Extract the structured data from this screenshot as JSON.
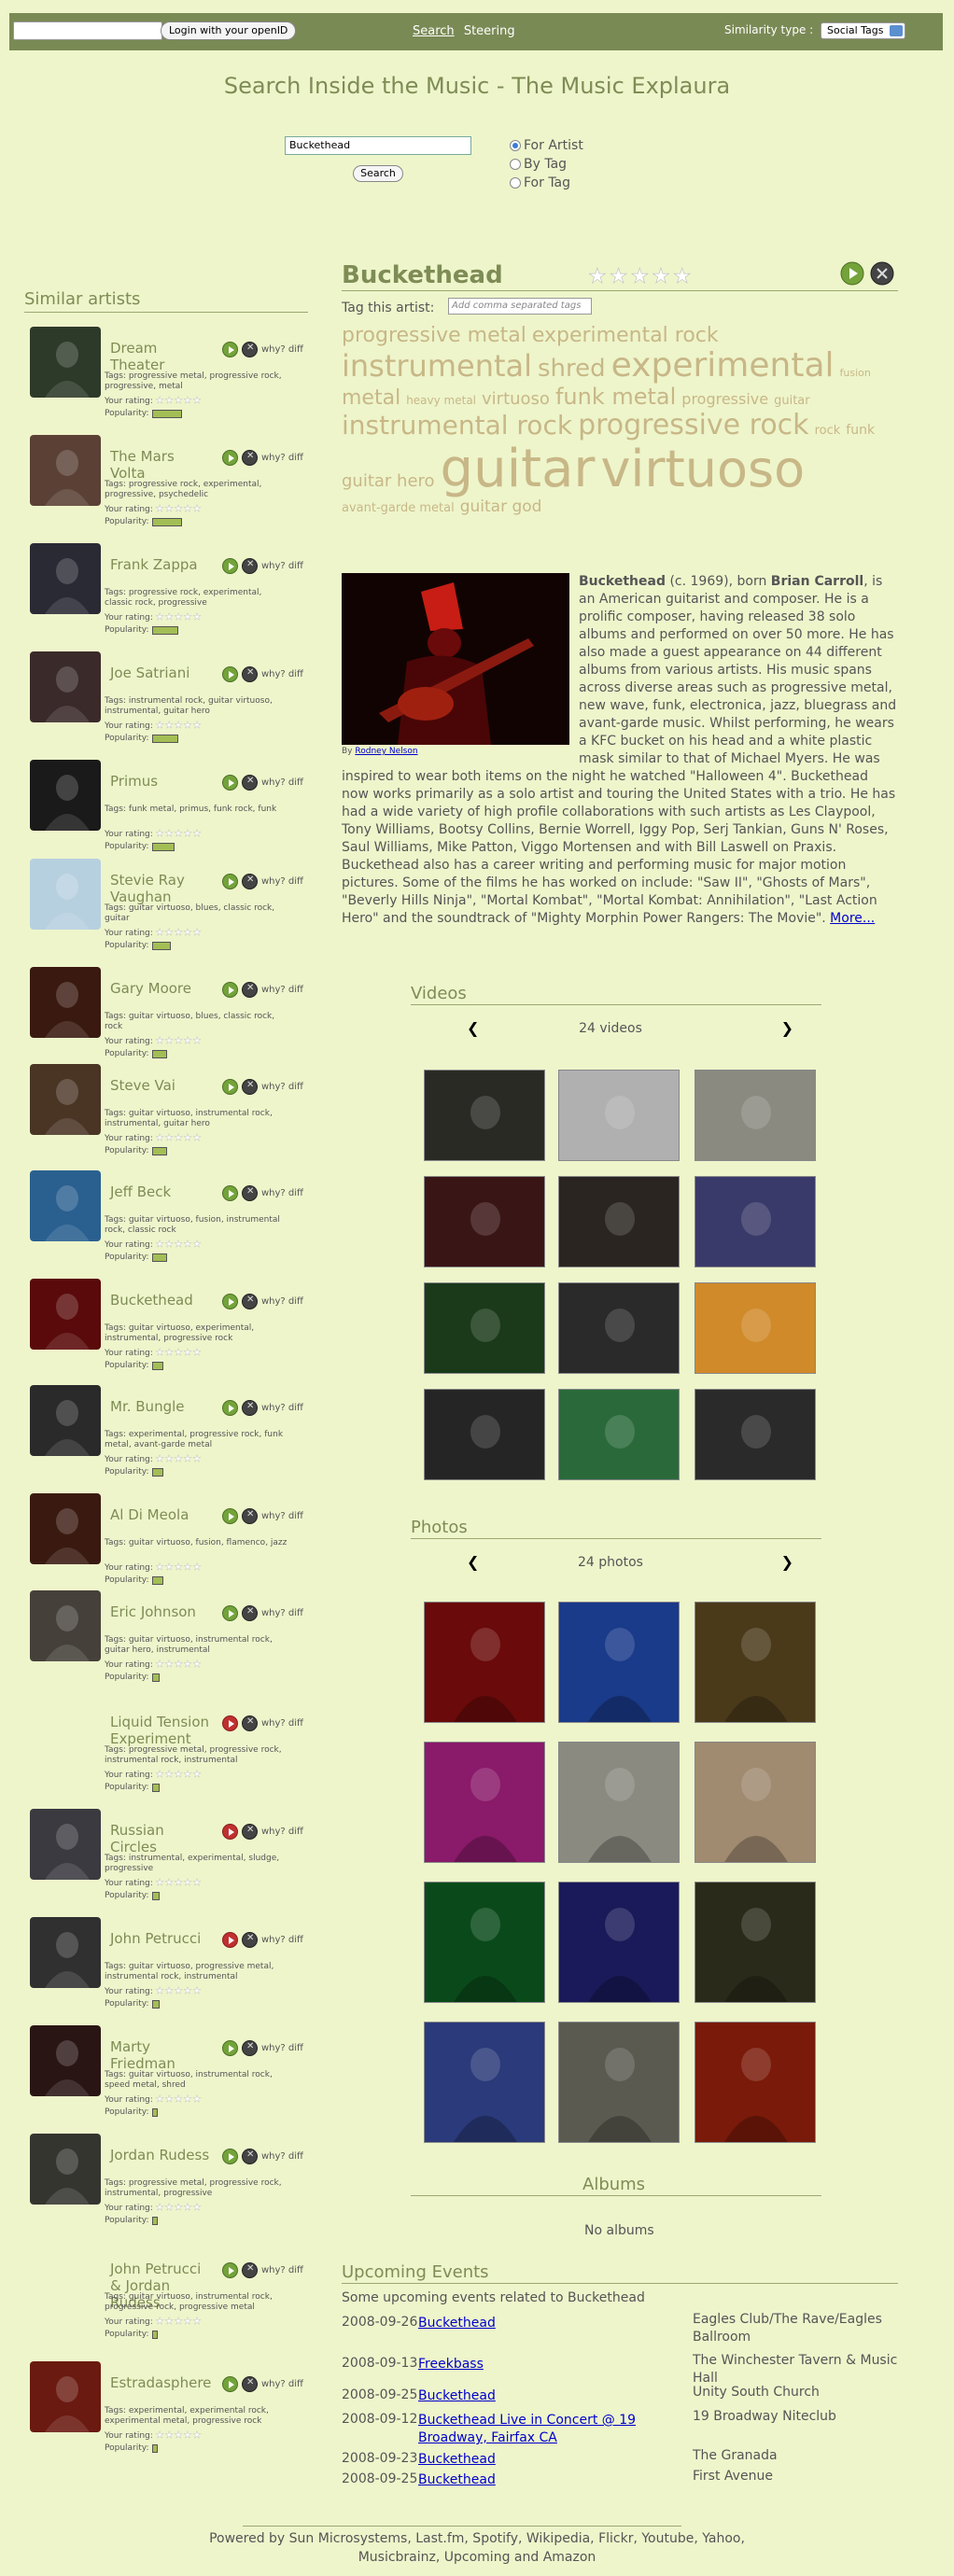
{
  "topbar": {
    "login_label": "Login with your openID",
    "nav_search": "Search",
    "nav_steering": "Steering",
    "similarity_label": "Similarity type :",
    "similarity_value": "Social Tags"
  },
  "page_title": "Search Inside the Music - The Music Explaura",
  "search": {
    "query": "Buckethead",
    "button": "Search",
    "options": [
      "For Artist",
      "By Tag",
      "For Tag"
    ],
    "selected": "For Artist"
  },
  "similar": {
    "title": "Similar artists",
    "tags_prefix": "Tags:",
    "rating_label": "Your rating:",
    "popularity_label": "Popularity:",
    "why_label": "why? diff",
    "items": [
      {
        "name": "Dream Theater",
        "tags": "progressive metal, progressive rock, progressive, metal",
        "popularity": 0.8,
        "play": "green",
        "thumb": "#2d3a2a"
      },
      {
        "name": "The Mars Volta",
        "tags": "progressive rock, experimental, progressive, psychedelic",
        "popularity": 0.8,
        "play": "green",
        "thumb": "#5a4035"
      },
      {
        "name": "Frank Zappa",
        "tags": "progressive rock, experimental, classic rock, progressive",
        "popularity": 0.7,
        "play": "green",
        "thumb": "#2a2a35"
      },
      {
        "name": "Joe Satriani",
        "tags": "instrumental rock, guitar virtuoso, instrumental, guitar hero",
        "popularity": 0.7,
        "play": "green",
        "thumb": "#3a2a2a"
      },
      {
        "name": "Primus",
        "tags": "funk metal, primus, funk rock, funk",
        "popularity": 0.6,
        "play": "green",
        "thumb": "#1a1a1a"
      },
      {
        "name": "Stevie Ray Vaughan",
        "tags": "guitar virtuoso, blues, classic rock, guitar",
        "popularity": 0.5,
        "play": "green",
        "thumb": "#b7d0e0"
      },
      {
        "name": "Gary Moore",
        "tags": "guitar virtuoso, blues, classic rock, rock",
        "popularity": 0.4,
        "play": "green",
        "thumb": "#3a1a10"
      },
      {
        "name": "Steve Vai",
        "tags": "guitar virtuoso, instrumental rock, instrumental, guitar hero",
        "popularity": 0.4,
        "play": "green",
        "thumb": "#4a3525"
      },
      {
        "name": "Jeff Beck",
        "tags": "guitar virtuoso, fusion, instrumental rock, classic rock",
        "popularity": 0.4,
        "play": "green",
        "thumb": "#2a6090"
      },
      {
        "name": "Buckethead",
        "tags": "guitar virtuoso, experimental, instrumental, progressive rock",
        "popularity": 0.3,
        "play": "green",
        "thumb": "#5a0a0a"
      },
      {
        "name": "Mr. Bungle",
        "tags": "experimental, progressive rock, funk metal, avant-garde metal",
        "popularity": 0.3,
        "play": "green",
        "thumb": "#2a2a2a"
      },
      {
        "name": "Al Di Meola",
        "tags": "guitar virtuoso, fusion, flamenco, jazz",
        "popularity": 0.3,
        "play": "green",
        "thumb": "#3a1a10"
      },
      {
        "name": "Eric Johnson",
        "tags": "guitar virtuoso, instrumental rock, guitar hero, instrumental",
        "popularity": 0.2,
        "play": "green",
        "thumb": "#45403a"
      },
      {
        "name": "Liquid Tension Experiment",
        "tags": "progressive metal, progressive rock, instrumental rock, instrumental",
        "popularity": 0.2,
        "play": "red",
        "thumb": ""
      },
      {
        "name": "Russian Circles",
        "tags": "instrumental, experimental, sludge, progressive",
        "popularity": 0.2,
        "play": "red",
        "thumb": "#3a3a40"
      },
      {
        "name": "John Petrucci",
        "tags": "guitar virtuoso, progressive metal, instrumental rock, instrumental",
        "popularity": 0.2,
        "play": "red",
        "thumb": "#303030"
      },
      {
        "name": "Marty Friedman",
        "tags": "guitar virtuoso, instrumental rock, speed metal, shred",
        "popularity": 0.15,
        "play": "green",
        "thumb": "#2a1515"
      },
      {
        "name": "Jordan Rudess",
        "tags": "progressive metal, progressive rock, instrumental, progressive",
        "popularity": 0.15,
        "play": "green",
        "thumb": "#353530"
      },
      {
        "name": "John Petrucci & Jordan Rudess",
        "tags": "guitar virtuoso, instrumental rock, progressive rock, progressive metal",
        "popularity": 0.15,
        "play": "green",
        "thumb": ""
      },
      {
        "name": "Estradasphere",
        "tags": "experimental, experimental rock, experimental metal, progressive rock",
        "popularity": 0.15,
        "play": "green",
        "thumb": "#6a1a10"
      }
    ]
  },
  "artist": {
    "name": "Buckethead",
    "tag_this_label": "Tag this artist:",
    "tag_placeholder": "Add comma separated tags",
    "cloud": [
      {
        "t": "progressive metal",
        "s": 22
      },
      {
        "t": "experimental rock",
        "s": 22
      },
      {
        "t": "instrumental",
        "s": 32
      },
      {
        "t": "shred",
        "s": 26
      },
      {
        "t": "experimental",
        "s": 36
      },
      {
        "t": "fusion",
        "s": 11
      },
      {
        "t": "metal",
        "s": 22
      },
      {
        "t": "heavy metal",
        "s": 12
      },
      {
        "t": "virtuoso",
        "s": 18
      },
      {
        "t": "funk metal",
        "s": 24
      },
      {
        "t": "progressive",
        "s": 16
      },
      {
        "t": "guitar",
        "s": 13
      },
      {
        "t": "instrumental rock",
        "s": 28
      },
      {
        "t": "progressive rock",
        "s": 30
      },
      {
        "t": "rock",
        "s": 13
      },
      {
        "t": "funk",
        "s": 14
      },
      {
        "t": "guitar hero",
        "s": 18
      },
      {
        "t": "guitar",
        "s": 56
      },
      {
        "t": "virtuoso",
        "s": 54
      },
      {
        "t": "avant-garde metal",
        "s": 13
      },
      {
        "t": "guitar god",
        "s": 17
      }
    ],
    "photo_credit_prefix": "By",
    "photo_credit_name": "Rodney Nelson",
    "bio_name": "Buckethead",
    "bio_born": " (c. 1969), born ",
    "bio_realname": "Brian Carroll",
    "bio_text": ", is an American guitarist and composer. He is a prolific composer, having released 38 solo albums and performed on over 50 more. He has also made a guest appearance on 44 different albums from various artists. His music spans across diverse areas such as progressive metal, new wave, funk, electronica, jazz, bluegrass and avant-garde music. Whilst performing, he wears a KFC bucket on his head and a white plastic mask similar to that of Michael Myers. He was inspired to wear both items on the night he watched \"Halloween 4\". Buckethead now works primarily as a solo artist and touring the United States with a trio. He has had a wide variety of high profile collaborations with such artists as Les Claypool, Tony Williams, Bootsy Collins, Bernie Worrell, Iggy Pop, Serj Tankian, Guns N' Roses, Saul Williams, Mike Patton, Viggo Mortensen and with Bill Laswell on Praxis. Buckethead also has a career writing and performing music for major motion pictures. Some of the films he has worked on include: \"Saw II\", \"Ghosts of Mars\", \"Beverly Hills Ninja\", \"Mortal Kombat\", \"Mortal Kombat: Annihilation\", \"Last Action Hero\" and the soundtrack of \"Mighty Morphin Power Rangers: The Movie\". ",
    "bio_more": "More..."
  },
  "videos": {
    "title": "Videos",
    "count_label": "24 videos",
    "prev": "❮",
    "next": "❯",
    "thumbs": [
      "#2a2a25",
      "#b0b0b0",
      "#8a8a80",
      "#3a1515",
      "#2a2520",
      "#3a3a6a",
      "#1a3a1a",
      "#2a2a2a",
      "#d08a2a",
      "#252525",
      "#2a6a3a",
      "#2a2a2a"
    ]
  },
  "photos": {
    "title": "Photos",
    "count_label": "24 photos",
    "prev": "❮",
    "next": "❯",
    "thumbs": [
      "#6a0a0a",
      "#1a3a8a",
      "#4a3a1a",
      "#8a1a6a",
      "#8a8a80",
      "#a08a70",
      "#0a4a1a",
      "#1a1a5a",
      "#2a2a1a",
      "#2a3a7a",
      "#5a5a50",
      "#7a1a0a"
    ]
  },
  "albums": {
    "title": "Albums",
    "empty": "No albums"
  },
  "events": {
    "title": "Upcoming Events",
    "subtitle": "Some upcoming events related to Buckethead",
    "items": [
      {
        "date": "2008-09-26",
        "name": "Buckethead",
        "venue": "Eagles Club/The Rave/Eagles Ballroom"
      },
      {
        "date": "2008-09-13",
        "name": "Freekbass",
        "venue": "The Winchester Tavern & Music Hall"
      },
      {
        "date": "2008-09-25",
        "name": "Buckethead",
        "venue": "Unity South Church"
      },
      {
        "date": "2008-09-12",
        "name": "Buckethead Live in Concert @ 19 Broadway, Fairfax CA",
        "venue": "19 Broadway Niteclub"
      },
      {
        "date": "2008-09-23",
        "name": "Buckethead",
        "venue": "The Granada"
      },
      {
        "date": "2008-09-25",
        "name": "Buckethead",
        "venue": "First Avenue"
      }
    ]
  },
  "footer": "Powered by Sun Microsystems, Last.fm, Spotify, Wikipedia, Flickr, Youtube, Yahoo, Musicbrainz, Upcoming and Amazon",
  "colors": {
    "background": "#eef5cb",
    "topbar": "#7a8a55",
    "heading": "#7e8c55",
    "tag": "#c8b787"
  }
}
